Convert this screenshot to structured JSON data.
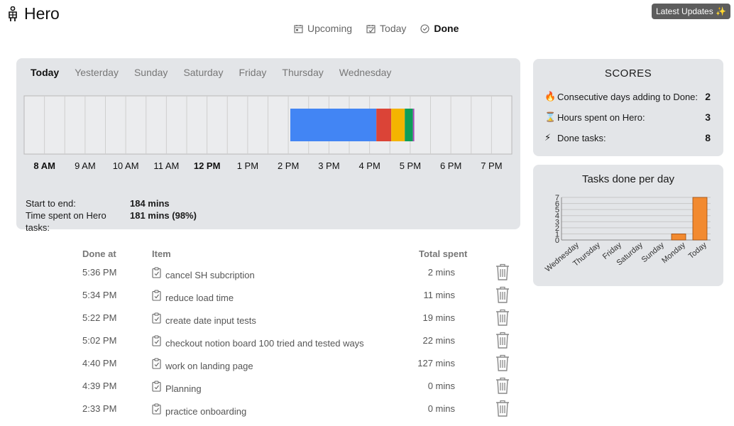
{
  "app": {
    "title": "Hero"
  },
  "nav": {
    "items": [
      {
        "label": "Upcoming",
        "icon": "calendar-icon",
        "active": false
      },
      {
        "label": "Today",
        "icon": "calendar-today-icon",
        "active": false
      },
      {
        "label": "Done",
        "icon": "check-circle-icon",
        "active": true
      }
    ]
  },
  "updates_button": {
    "label": "Latest Updates ✨"
  },
  "timeline": {
    "day_tabs": [
      {
        "label": "Today",
        "active": true
      },
      {
        "label": "Yesterday",
        "active": false
      },
      {
        "label": "Sunday",
        "active": false
      },
      {
        "label": "Saturday",
        "active": false
      },
      {
        "label": "Friday",
        "active": false
      },
      {
        "label": "Thursday",
        "active": false
      },
      {
        "label": "Wednesday",
        "active": false
      }
    ],
    "hour_labels": [
      {
        "label": "8 AM",
        "bold": true
      },
      {
        "label": "9 AM",
        "bold": false
      },
      {
        "label": "10 AM",
        "bold": false
      },
      {
        "label": "11 AM",
        "bold": false
      },
      {
        "label": "12 PM",
        "bold": true
      },
      {
        "label": "1 PM",
        "bold": false
      },
      {
        "label": "2 PM",
        "bold": false
      },
      {
        "label": "3 PM",
        "bold": false
      },
      {
        "label": "4 PM",
        "bold": false
      },
      {
        "label": "5 PM",
        "bold": false
      },
      {
        "label": "6 PM",
        "bold": false
      },
      {
        "label": "7 PM",
        "bold": false
      }
    ],
    "range_hours": [
      8,
      20
    ],
    "segments": [
      {
        "start": "2:33 PM",
        "end": "4:40 PM",
        "color": "#4285f4"
      },
      {
        "start": "4:40 PM",
        "end": "5:02 PM",
        "color": "#db4437"
      },
      {
        "start": "5:02 PM",
        "end": "5:22 PM",
        "color": "#f4b400"
      },
      {
        "start": "5:22 PM",
        "end": "5:34 PM",
        "color": "#0f9d58"
      },
      {
        "start": "5:34 PM",
        "end": "5:36 PM",
        "color": "#ab47bc"
      }
    ],
    "summary": {
      "start_to_end_label": "Start to end:",
      "start_to_end_value": "184 mins",
      "time_spent_label": "Time spent on Hero tasks:",
      "time_spent_value": "181 mins (98%)"
    }
  },
  "scores": {
    "title": "SCORES",
    "rows": [
      {
        "icon": "🔥",
        "label": "Consecutive days adding to Done:",
        "value": "2"
      },
      {
        "icon": "⌛",
        "label": "Hours spent on Hero:",
        "value": "3"
      },
      {
        "icon": "⚡",
        "label": "Done tasks:",
        "value": "8"
      }
    ]
  },
  "chart_data": {
    "type": "bar",
    "title": "Tasks done per day",
    "categories": [
      "Wednesday",
      "Thursday",
      "Friday",
      "Saturday",
      "Sunday",
      "Monday",
      "Today"
    ],
    "values": [
      0,
      0,
      0,
      0,
      0,
      1,
      7
    ],
    "ylim": [
      0,
      7
    ],
    "yticks": [
      0,
      1,
      2,
      3,
      4,
      5,
      6,
      7
    ],
    "bar_color": "#f28a30",
    "grid": true
  },
  "tasks": {
    "headers": {
      "done_at": "Done at",
      "item": "Item",
      "total_spent": "Total spent"
    },
    "rows": [
      {
        "done_at": "5:36 PM",
        "item": "cancel SH subcription",
        "total_spent": "2 mins"
      },
      {
        "done_at": "5:34 PM",
        "item": "reduce load time",
        "total_spent": "11 mins"
      },
      {
        "done_at": "5:22 PM",
        "item": "create date input tests",
        "total_spent": "19 mins"
      },
      {
        "done_at": "5:02 PM",
        "item": "checkout notion board 100 tried and tested ways",
        "total_spent": "22 mins"
      },
      {
        "done_at": "4:40 PM",
        "item": "work on landing page",
        "total_spent": "127 mins"
      },
      {
        "done_at": "4:39 PM",
        "item": "Planning",
        "total_spent": "0 mins"
      },
      {
        "done_at": "2:33 PM",
        "item": "practice onboarding",
        "total_spent": "0 mins"
      }
    ]
  }
}
